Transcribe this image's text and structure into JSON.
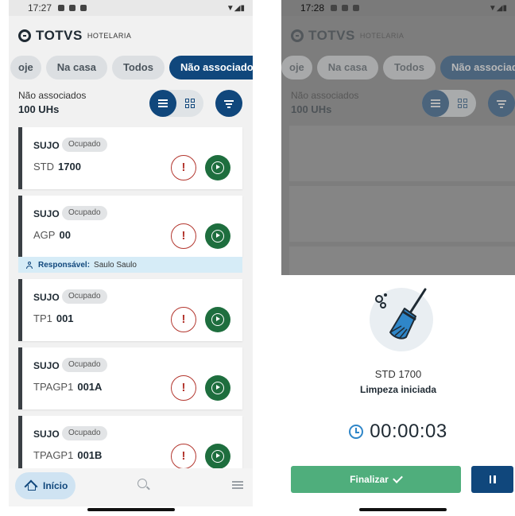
{
  "left_screen": {
    "status_bar": {
      "time": "17:27"
    },
    "brand": {
      "name": "TOTVS",
      "sub": "HOTELARIA"
    },
    "filter_chips": [
      {
        "label": "oje",
        "active": false
      },
      {
        "label": "Na casa",
        "active": false
      },
      {
        "label": "Todos",
        "active": false
      },
      {
        "label": "Não associados",
        "active": true
      }
    ],
    "summary": {
      "label": "Não associados",
      "value": "100 UHs"
    },
    "cards": [
      {
        "status": "SUJO",
        "badge": "Ocupado",
        "room_type": "STD",
        "room_number": "1700",
        "alert_icon": "!"
      },
      {
        "status": "SUJO",
        "badge": "Ocupado",
        "room_type": "AGP",
        "room_number": "00",
        "alert_icon": "!"
      },
      {
        "status": "SUJO",
        "badge": "Ocupado",
        "room_type": "TP1",
        "room_number": "001",
        "alert_icon": "!"
      },
      {
        "status": "SUJO",
        "badge": "Ocupado",
        "room_type": "TPAGP1",
        "room_number": "001A",
        "alert_icon": "!"
      },
      {
        "status": "SUJO",
        "badge": "Ocupado",
        "room_type": "TPAGP1",
        "room_number": "001B",
        "alert_icon": "!"
      }
    ],
    "responsavel": {
      "label": "Responsável:",
      "name": "Saulo Saulo"
    },
    "bottom_nav": {
      "home_label": "Início"
    }
  },
  "right_screen": {
    "status_bar": {
      "time": "17:28"
    },
    "brand": {
      "name": "TOTVS",
      "sub": "HOTELARIA"
    },
    "filter_chips": [
      {
        "label": "oje"
      },
      {
        "label": "Na casa"
      },
      {
        "label": "Todos"
      },
      {
        "label": "Não associados"
      }
    ],
    "summary": {
      "label": "Não associados",
      "value": "100 UHs"
    },
    "sheet": {
      "room": "STD 1700",
      "status": "Limpeza iniciada",
      "timer": "00:00:03",
      "finish_label": "Finalizar"
    }
  },
  "colors": {
    "primary": "#10477c",
    "success": "#1e6e3e",
    "finish": "#4fae7c",
    "alert": "#b3362e",
    "timer_icon": "#2f86c8"
  }
}
